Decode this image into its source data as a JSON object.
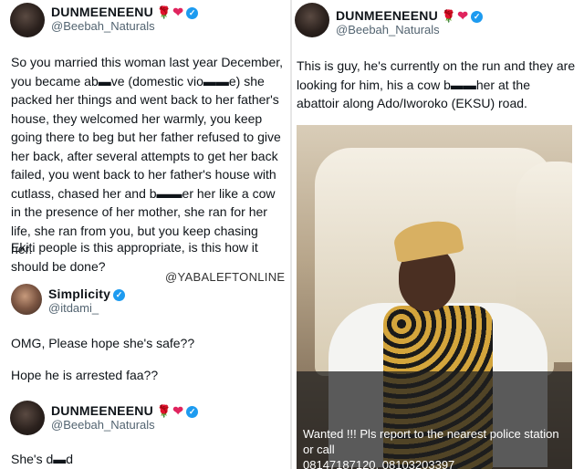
{
  "left": {
    "tweet1": {
      "name": "DUNMEENEENU",
      "handle": "@Beebah_Naturals",
      "body": "So you married this woman last year December, you became ab▬ve (domestic vio▬▬e) she packed her things and went back to her father's house, they welcomed her warmly, you keep going there to beg but her father refused to give her back, after several attempts to get her back failed, you went back to her father's house with cutlass, chased her and b▬▬er her like a cow in the presence of her mother, she ran for her life, she ran from you, but you keep chasing her.",
      "body2": "Ekiti people is this appropriate, is this how it should be done?"
    },
    "watermark": "@YABALEFTONLINE",
    "reply1": {
      "name": "Simplicity",
      "handle": "@itdami_",
      "line1": "OMG, Please hope she's safe??",
      "line2": "Hope he is arrested faa??"
    },
    "reply2": {
      "name": "DUNMEENEENU",
      "handle": "@Beebah_Naturals",
      "body": "She's d▬d"
    }
  },
  "right": {
    "tweet": {
      "name": "DUNMEENEENU",
      "handle": "@Beebah_Naturals",
      "body": "This is guy, he's currently on the run and they are looking for him, his a cow b▬▬her at the abattoir along Ado/Iworoko (EKSU) road."
    },
    "photo_caption": {
      "line1": "Wanted !!! Pls report to the nearest police station or call",
      "line2": "08147187120, 08103203397"
    }
  },
  "icons": {
    "rose": "rose-emoji-icon",
    "heart": "red-heart-icon",
    "verified": "verified-badge-icon"
  },
  "colors": {
    "verified": "#1d9bf0",
    "handle": "#536471"
  }
}
